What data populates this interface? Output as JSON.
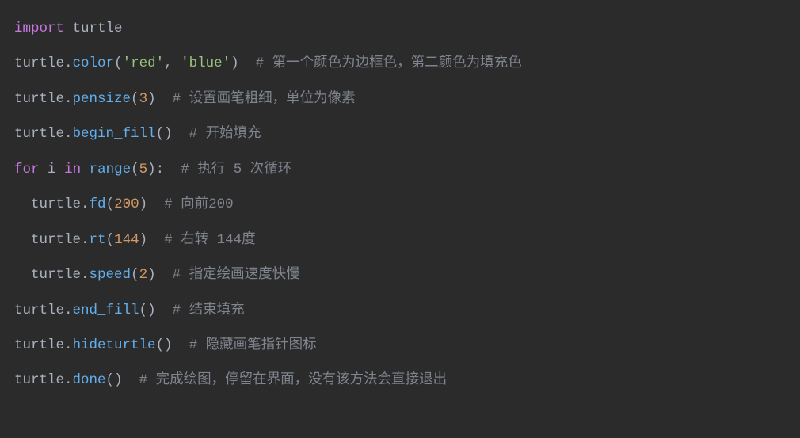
{
  "code": {
    "line1": {
      "kw": "import",
      "mod": "turtle"
    },
    "line2": {
      "obj": "turtle",
      "dot": ".",
      "fn": "color",
      "open": "(",
      "arg1": "'red'",
      "comma": ",",
      "arg2": "'blue'",
      "close": ")",
      "cmt": "# 第一个颜色为边框色，第二颜色为填充色"
    },
    "line3": {
      "obj": "turtle",
      "dot": ".",
      "fn": "pensize",
      "open": "(",
      "arg": "3",
      "close": ")",
      "cmt": "# 设置画笔粗细，单位为像素"
    },
    "line4": {
      "obj": "turtle",
      "dot": ".",
      "fn": "begin_fill",
      "open": "(",
      "close": ")",
      "cmt": "# 开始填充"
    },
    "line5": {
      "kw1": "for",
      "var": "i",
      "kw2": "in",
      "fn": "range",
      "open": "(",
      "arg": "5",
      "close": ")",
      "colon": ":",
      "cmt": "# 执行 5 次循环"
    },
    "line6": {
      "obj": "turtle",
      "dot": ".",
      "fn": "fd",
      "open": "(",
      "arg": "200",
      "close": ")",
      "cmt": "# 向前200"
    },
    "line7": {
      "obj": "turtle",
      "dot": ".",
      "fn": "rt",
      "open": "(",
      "arg": "144",
      "close": ")",
      "cmt": "# 右转 144度"
    },
    "line8": {
      "obj": "turtle",
      "dot": ".",
      "fn": "speed",
      "open": "(",
      "arg": "2",
      "close": ")",
      "cmt": "# 指定绘画速度快慢"
    },
    "line9": {
      "obj": "turtle",
      "dot": ".",
      "fn": "end_fill",
      "open": "(",
      "close": ")",
      "cmt": "# 结束填充"
    },
    "line10": {
      "obj": "turtle",
      "dot": ".",
      "fn": "hideturtle",
      "open": "(",
      "close": ")",
      "cmt": "# 隐藏画笔指针图标"
    },
    "line11": {
      "obj": "turtle",
      "dot": ".",
      "fn": "done",
      "open": "(",
      "close": ")",
      "cmt": "# 完成绘图，停留在界面，没有该方法会直接退出"
    }
  }
}
